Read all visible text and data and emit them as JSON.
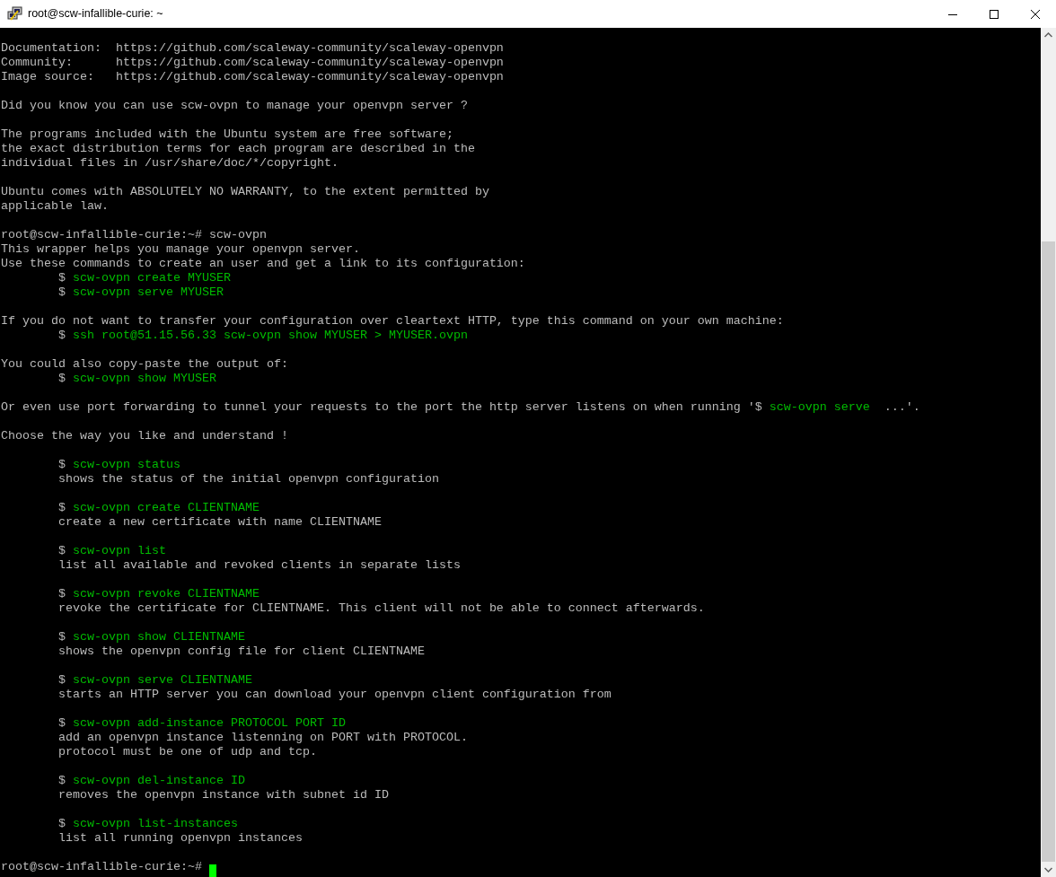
{
  "window": {
    "title": "root@scw-infallible-curie: ~"
  },
  "terminal": {
    "blocks": [
      [
        {
          "segments": [
            {
              "kind": "plain",
              "text": "Documentation:  https://github.com/scaleway-community/scaleway-openvpn"
            }
          ]
        },
        {
          "segments": [
            {
              "kind": "plain",
              "text": "Community:      https://github.com/scaleway-community/scaleway-openvpn"
            }
          ]
        },
        {
          "segments": [
            {
              "kind": "plain",
              "text": "Image source:   https://github.com/scaleway-community/scaleway-openvpn"
            }
          ]
        }
      ],
      [
        {
          "segments": [
            {
              "kind": "plain",
              "text": "Did you know you can use scw-ovpn to manage your openvpn server ?"
            }
          ]
        }
      ],
      [
        {
          "segments": [
            {
              "kind": "plain",
              "text": "The programs included with the Ubuntu system are free software;"
            }
          ]
        },
        {
          "segments": [
            {
              "kind": "plain",
              "text": "the exact distribution terms for each program are described in the"
            }
          ]
        },
        {
          "segments": [
            {
              "kind": "plain",
              "text": "individual files in /usr/share/doc/*/copyright."
            }
          ]
        }
      ],
      [
        {
          "segments": [
            {
              "kind": "plain",
              "text": "Ubuntu comes with ABSOLUTELY NO WARRANTY, to the extent permitted by"
            }
          ]
        },
        {
          "segments": [
            {
              "kind": "plain",
              "text": "applicable law."
            }
          ]
        }
      ],
      [
        {
          "segments": [
            {
              "kind": "plain",
              "text": "root@scw-infallible-curie:~# scw-ovpn"
            }
          ]
        },
        {
          "segments": [
            {
              "kind": "plain",
              "text": "This wrapper helps you manage your openvpn server."
            }
          ]
        },
        {
          "segments": [
            {
              "kind": "plain",
              "text": "Use these commands to create an user and get a link to its configuration:"
            }
          ]
        },
        {
          "segments": [
            {
              "kind": "plain",
              "text": "        $ "
            },
            {
              "kind": "command",
              "text": "scw-ovpn create MYUSER"
            }
          ]
        },
        {
          "segments": [
            {
              "kind": "plain",
              "text": "        $ "
            },
            {
              "kind": "command",
              "text": "scw-ovpn serve MYUSER"
            }
          ]
        }
      ],
      [
        {
          "segments": [
            {
              "kind": "plain",
              "text": "If you do not want to transfer your configuration over cleartext HTTP, type this command on your own machine:"
            }
          ]
        },
        {
          "segments": [
            {
              "kind": "plain",
              "text": "        $ "
            },
            {
              "kind": "command",
              "text": "ssh root@51.15.56.33 scw-ovpn show MYUSER > MYUSER.ovpn"
            }
          ]
        }
      ],
      [
        {
          "segments": [
            {
              "kind": "plain",
              "text": "You could also copy-paste the output of:"
            }
          ]
        },
        {
          "segments": [
            {
              "kind": "plain",
              "text": "        $ "
            },
            {
              "kind": "command",
              "text": "scw-ovpn show MYUSER"
            }
          ]
        }
      ],
      [
        {
          "segments": [
            {
              "kind": "plain",
              "text": "Or even use port forwarding to tunnel your requests to the port the http server listens on when running '$ "
            },
            {
              "kind": "command",
              "text": "scw-ovpn serve"
            },
            {
              "kind": "plain",
              "text": "  ...'."
            }
          ]
        }
      ],
      [
        {
          "segments": [
            {
              "kind": "plain",
              "text": "Choose the way you like and understand !"
            }
          ]
        }
      ],
      [
        {
          "segments": [
            {
              "kind": "plain",
              "text": "        $ "
            },
            {
              "kind": "command",
              "text": "scw-ovpn status"
            }
          ]
        },
        {
          "segments": [
            {
              "kind": "plain",
              "text": "        shows the status of the initial openvpn configuration"
            }
          ]
        }
      ],
      [
        {
          "segments": [
            {
              "kind": "plain",
              "text": "        $ "
            },
            {
              "kind": "command",
              "text": "scw-ovpn create CLIENTNAME"
            }
          ]
        },
        {
          "segments": [
            {
              "kind": "plain",
              "text": "        create a new certificate with name CLIENTNAME"
            }
          ]
        }
      ],
      [
        {
          "segments": [
            {
              "kind": "plain",
              "text": "        $ "
            },
            {
              "kind": "command",
              "text": "scw-ovpn list"
            }
          ]
        },
        {
          "segments": [
            {
              "kind": "plain",
              "text": "        list all available and revoked clients in separate lists"
            }
          ]
        }
      ],
      [
        {
          "segments": [
            {
              "kind": "plain",
              "text": "        $ "
            },
            {
              "kind": "command",
              "text": "scw-ovpn revoke CLIENTNAME"
            }
          ]
        },
        {
          "segments": [
            {
              "kind": "plain",
              "text": "        revoke the certificate for CLIENTNAME. This client will not be able to connect afterwards."
            }
          ]
        }
      ],
      [
        {
          "segments": [
            {
              "kind": "plain",
              "text": "        $ "
            },
            {
              "kind": "command",
              "text": "scw-ovpn show CLIENTNAME"
            }
          ]
        },
        {
          "segments": [
            {
              "kind": "plain",
              "text": "        shows the openvpn config file for client CLIENTNAME"
            }
          ]
        }
      ],
      [
        {
          "segments": [
            {
              "kind": "plain",
              "text": "        $ "
            },
            {
              "kind": "command",
              "text": "scw-ovpn serve CLIENTNAME"
            }
          ]
        },
        {
          "segments": [
            {
              "kind": "plain",
              "text": "        starts an HTTP server you can download your openvpn client configuration from"
            }
          ]
        }
      ],
      [
        {
          "segments": [
            {
              "kind": "plain",
              "text": "        $ "
            },
            {
              "kind": "command",
              "text": "scw-ovpn add-instance PROTOCOL PORT ID"
            }
          ]
        },
        {
          "segments": [
            {
              "kind": "plain",
              "text": "        add an openvpn instance listenning on PORT with PROTOCOL."
            }
          ]
        },
        {
          "segments": [
            {
              "kind": "plain",
              "text": "        protocol must be one of udp and tcp."
            }
          ]
        }
      ],
      [
        {
          "segments": [
            {
              "kind": "plain",
              "text": "        $ "
            },
            {
              "kind": "command",
              "text": "scw-ovpn del-instance ID"
            }
          ]
        },
        {
          "segments": [
            {
              "kind": "plain",
              "text": "        removes the openvpn instance with subnet id ID"
            }
          ]
        }
      ],
      [
        {
          "segments": [
            {
              "kind": "plain",
              "text": "        $ "
            },
            {
              "kind": "command",
              "text": "scw-ovpn list-instances"
            }
          ]
        },
        {
          "segments": [
            {
              "kind": "plain",
              "text": "        list all running openvpn instances"
            }
          ]
        }
      ],
      [
        {
          "segments": [
            {
              "kind": "plain",
              "text": "root@scw-infallible-curie:~# "
            }
          ],
          "cursor": true
        }
      ]
    ]
  }
}
